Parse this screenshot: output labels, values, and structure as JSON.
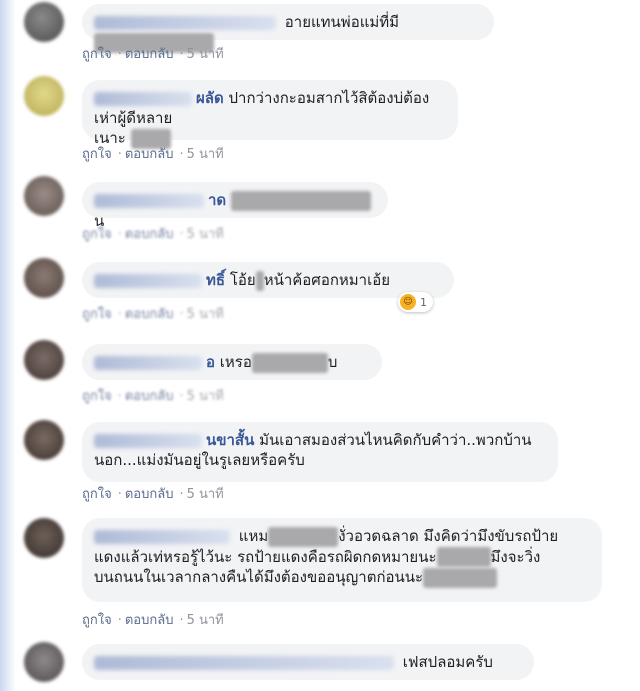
{
  "comments": [
    {
      "text_a": "อายแทนพ่อแม่ที่มี",
      "text_b": "",
      "text_c": "",
      "meta": {
        "like": "ถูกใจ",
        "reply": "ตอบกลับ",
        "time": "5 นาที"
      }
    },
    {
      "name_visible": "ผลัด",
      "text_a": "ปากว่างกะอมสากไว้สิต้องบ่ต้องเห่าผู้ดีหลาย",
      "text_b": "เนาะ",
      "meta": {
        "like": "ถูกใจ",
        "reply": "ตอบกลับ",
        "time": "5 นาที"
      }
    },
    {
      "name_visible": "าด",
      "text_a": "น",
      "meta": {
        "like": "ถูกใจ",
        "reply": "ตอบกลับ",
        "time": "5 นาที"
      }
    },
    {
      "name_visible": "ทธิ์",
      "text_a": "โอ้ย",
      "text_b": "หน้าค้อศอกหมาเอ้ย",
      "reaction_count": "1",
      "meta": {
        "like": "ถูกใจ",
        "reply": "ตอบกลับ",
        "time": "5 นาที"
      }
    },
    {
      "name_visible": "อ",
      "text_a": "เหรอ",
      "text_b": "บ",
      "meta": {
        "like": "ถูกใจ",
        "reply": "ตอบกลับ",
        "time": "5 นาที"
      }
    },
    {
      "name_visible": "นขาสั้น",
      "text_a": "มันเอาสมองส่วนไหนคิดกับคำว่า..พวกบ้าน",
      "text_b": "นอก...แม่งมันอยู่ในรูเลยหรือครับ",
      "meta": {
        "like": "ถูกใจ",
        "reply": "ตอบกลับ",
        "time": "5 นาที"
      }
    },
    {
      "text_a": "แหม",
      "text_a2": "งั่วอวดฉลาด มึงคิดว่ามึงขับรถป้าย",
      "text_b": "แดงแล้วเท่หรอรู้ไว้นะ รถป้ายแดงคือรถผิดกดหมายนะ",
      "text_b2": "มึงจะวิ่ง",
      "text_c": "บนถนนในเวลากลางคืนได้มึงต้องขออนุญาตก่อนนะ",
      "meta": {
        "like": "ถูกใจ",
        "reply": "ตอบกลับ",
        "time": "5 นาที"
      }
    },
    {
      "text_a": "เฟสปลอมครับ"
    }
  ]
}
